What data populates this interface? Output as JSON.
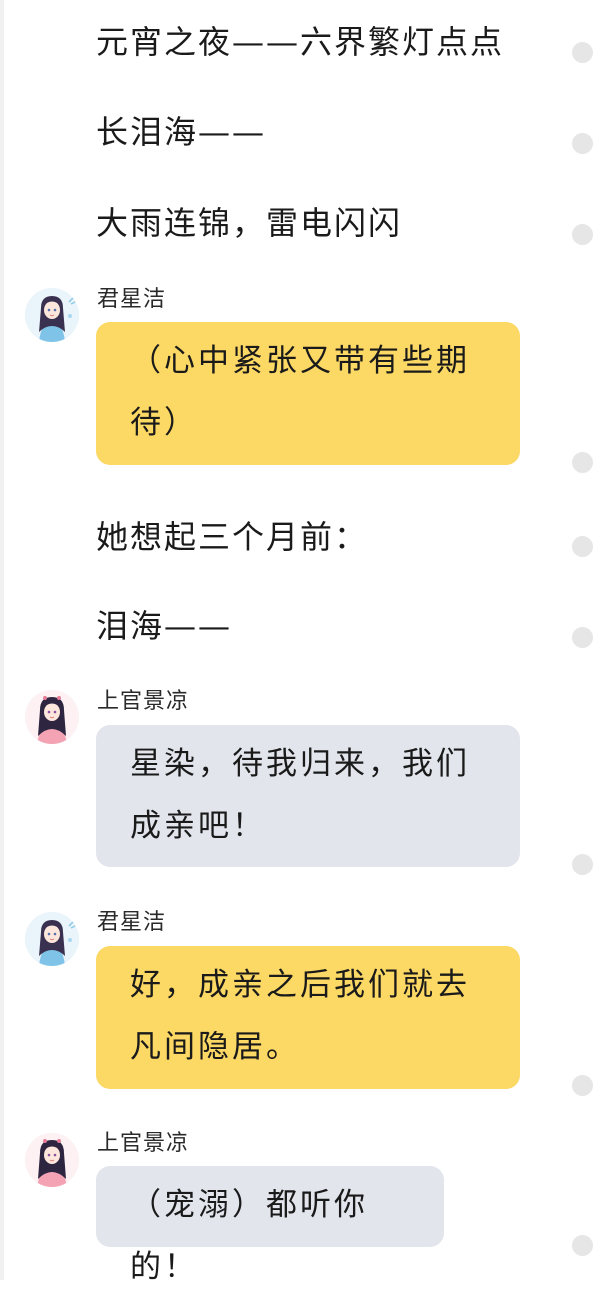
{
  "narration": [
    "元宵之夜——六界繁灯点点",
    "长泪海——",
    "大雨连锦，雷电闪闪",
    "她想起三个月前：",
    "泪海——"
  ],
  "speakers": {
    "junxingjie": "君星洁",
    "shangguan": "上官景凉"
  },
  "messages": [
    {
      "speaker": "君星洁",
      "text": "（心中紧张又带有些期待）",
      "style": "yellow"
    },
    {
      "speaker": "上官景凉",
      "text": "星染，待我归来，我们成亲吧！",
      "style": "grey"
    },
    {
      "speaker": "君星洁",
      "text": "好，成亲之后我们就去凡间隐居。",
      "style": "yellow"
    },
    {
      "speaker": "上官景凉",
      "text": "（宠溺）都听你的！",
      "style": "grey"
    }
  ],
  "colors": {
    "yellow_bubble": "#fcd865",
    "grey_bubble": "#e2e5ec",
    "dot": "#e6e6e6"
  },
  "icons": {
    "junxingjie_avatar": "girl-blue-robe-avatar-icon",
    "shangguan_avatar": "girl-pink-robe-avatar-icon"
  }
}
